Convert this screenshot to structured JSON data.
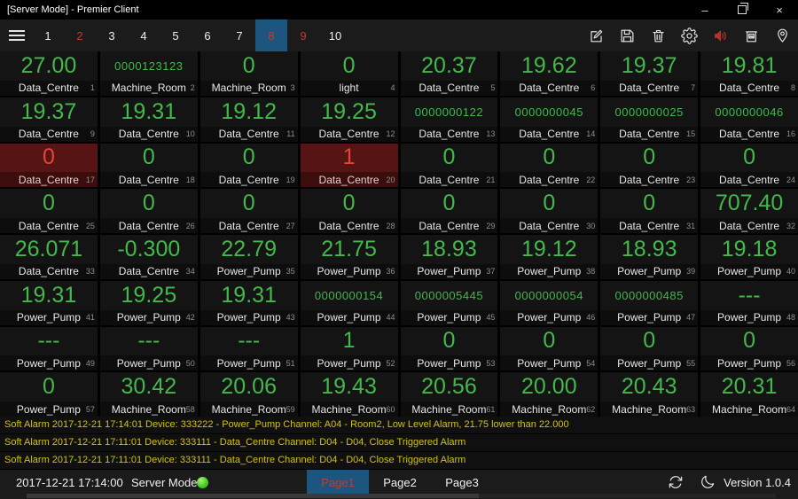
{
  "window": {
    "title": "[Server Mode] - Premier Client",
    "controls": [
      {
        "name": "minimize",
        "glyph": "–"
      },
      {
        "name": "restore",
        "glyph": ""
      },
      {
        "name": "close",
        "glyph": "×"
      }
    ]
  },
  "toolbar": {
    "pages": [
      {
        "label": "1",
        "state": "normal"
      },
      {
        "label": "2",
        "state": "alarm"
      },
      {
        "label": "3",
        "state": "normal"
      },
      {
        "label": "4",
        "state": "normal"
      },
      {
        "label": "5",
        "state": "normal"
      },
      {
        "label": "6",
        "state": "normal"
      },
      {
        "label": "7",
        "state": "normal"
      },
      {
        "label": "8",
        "state": "active"
      },
      {
        "label": "9",
        "state": "alarm"
      },
      {
        "label": "10",
        "state": "normal"
      }
    ],
    "icons": [
      "edit",
      "save",
      "delete",
      "settings",
      "alarm-sound",
      "snapshot",
      "location"
    ]
  },
  "grid": {
    "cells": [
      {
        "value": "27.00",
        "label": "Data_Centre",
        "index": 1,
        "state": "normal"
      },
      {
        "value": "0000123123",
        "label": "Machine_Room",
        "index": 2,
        "state": "normal"
      },
      {
        "value": "0",
        "label": "Machine_Room",
        "index": 3,
        "state": "normal"
      },
      {
        "value": "0",
        "label": "light",
        "index": 4,
        "state": "normal"
      },
      {
        "value": "20.37",
        "label": "Data_Centre",
        "index": 5,
        "state": "normal"
      },
      {
        "value": "19.62",
        "label": "Data_Centre",
        "index": 6,
        "state": "normal"
      },
      {
        "value": "19.37",
        "label": "Data_Centre",
        "index": 7,
        "state": "normal"
      },
      {
        "value": "19.81",
        "label": "Data_Centre",
        "index": 8,
        "state": "normal"
      },
      {
        "value": "19.37",
        "label": "Data_Centre",
        "index": 9,
        "state": "normal"
      },
      {
        "value": "19.31",
        "label": "Data_Centre",
        "index": 10,
        "state": "normal"
      },
      {
        "value": "19.12",
        "label": "Data_Centre",
        "index": 11,
        "state": "normal"
      },
      {
        "value": "19.25",
        "label": "Data_Centre",
        "index": 12,
        "state": "normal"
      },
      {
        "value": "0000000122",
        "label": "Data_Centre",
        "index": 13,
        "state": "normal"
      },
      {
        "value": "0000000045",
        "label": "Data_Centre",
        "index": 14,
        "state": "normal"
      },
      {
        "value": "0000000025",
        "label": "Data_Centre",
        "index": 15,
        "state": "normal"
      },
      {
        "value": "0000000046",
        "label": "Data_Centre",
        "index": 16,
        "state": "normal"
      },
      {
        "value": "0",
        "label": "Data_Centre",
        "index": 17,
        "state": "alarm"
      },
      {
        "value": "0",
        "label": "Data_Centre",
        "index": 18,
        "state": "normal"
      },
      {
        "value": "0",
        "label": "Data_Centre",
        "index": 19,
        "state": "normal"
      },
      {
        "value": "1",
        "label": "Data_Centre",
        "index": 20,
        "state": "alarm"
      },
      {
        "value": "0",
        "label": "Data_Centre",
        "index": 21,
        "state": "normal"
      },
      {
        "value": "0",
        "label": "Data_Centre",
        "index": 22,
        "state": "normal"
      },
      {
        "value": "0",
        "label": "Data_Centre",
        "index": 23,
        "state": "normal"
      },
      {
        "value": "0",
        "label": "Data_Centre",
        "index": 24,
        "state": "normal"
      },
      {
        "value": "0",
        "label": "Data_Centre",
        "index": 25,
        "state": "normal"
      },
      {
        "value": "0",
        "label": "Data_Centre",
        "index": 26,
        "state": "normal"
      },
      {
        "value": "0",
        "label": "Data_Centre",
        "index": 27,
        "state": "normal"
      },
      {
        "value": "0",
        "label": "Data_Centre",
        "index": 28,
        "state": "normal"
      },
      {
        "value": "0",
        "label": "Data_Centre",
        "index": 29,
        "state": "normal"
      },
      {
        "value": "0",
        "label": "Data_Centre",
        "index": 30,
        "state": "normal"
      },
      {
        "value": "0",
        "label": "Data_Centre",
        "index": 31,
        "state": "normal"
      },
      {
        "value": "707.40",
        "label": "Data_Centre",
        "index": 32,
        "state": "normal"
      },
      {
        "value": "26.071",
        "label": "Data_Centre",
        "index": 33,
        "state": "normal"
      },
      {
        "value": "-0.300",
        "label": "Data_Centre",
        "index": 34,
        "state": "normal"
      },
      {
        "value": "22.79",
        "label": "Power_Pump",
        "index": 35,
        "state": "normal"
      },
      {
        "value": "21.75",
        "label": "Power_Pump",
        "index": 36,
        "state": "normal"
      },
      {
        "value": "18.93",
        "label": "Power_Pump",
        "index": 37,
        "state": "normal"
      },
      {
        "value": "19.12",
        "label": "Power_Pump",
        "index": 38,
        "state": "normal"
      },
      {
        "value": "18.93",
        "label": "Power_Pump",
        "index": 39,
        "state": "normal"
      },
      {
        "value": "19.18",
        "label": "Power_Pump",
        "index": 40,
        "state": "normal"
      },
      {
        "value": "19.31",
        "label": "Power_Pump",
        "index": 41,
        "state": "normal"
      },
      {
        "value": "19.25",
        "label": "Power_Pump",
        "index": 42,
        "state": "normal"
      },
      {
        "value": "19.31",
        "label": "Power_Pump",
        "index": 43,
        "state": "normal"
      },
      {
        "value": "0000000154",
        "label": "Power_Pump",
        "index": 44,
        "state": "normal"
      },
      {
        "value": "0000005445",
        "label": "Power_Pump",
        "index": 45,
        "state": "normal"
      },
      {
        "value": "0000000054",
        "label": "Power_Pump",
        "index": 46,
        "state": "normal"
      },
      {
        "value": "0000000485",
        "label": "Power_Pump",
        "index": 47,
        "state": "normal"
      },
      {
        "value": "---",
        "label": "Power_Pump",
        "index": 48,
        "state": "normal"
      },
      {
        "value": "---",
        "label": "Power_Pump",
        "index": 49,
        "state": "normal"
      },
      {
        "value": "---",
        "label": "Power_Pump",
        "index": 50,
        "state": "normal"
      },
      {
        "value": "---",
        "label": "Power_Pump",
        "index": 51,
        "state": "normal"
      },
      {
        "value": "1",
        "label": "Power_Pump",
        "index": 52,
        "state": "normal"
      },
      {
        "value": "0",
        "label": "Power_Pump",
        "index": 53,
        "state": "normal"
      },
      {
        "value": "0",
        "label": "Power_Pump",
        "index": 54,
        "state": "normal"
      },
      {
        "value": "0",
        "label": "Power_Pump",
        "index": 55,
        "state": "normal"
      },
      {
        "value": "0",
        "label": "Power_Pump",
        "index": 56,
        "state": "normal"
      },
      {
        "value": "0",
        "label": "Power_Pump",
        "index": 57,
        "state": "normal"
      },
      {
        "value": "30.42",
        "label": "Machine_Room",
        "index": 58,
        "state": "normal"
      },
      {
        "value": "20.06",
        "label": "Machine_Room",
        "index": 59,
        "state": "normal"
      },
      {
        "value": "19.43",
        "label": "Machine_Room",
        "index": 60,
        "state": "normal"
      },
      {
        "value": "20.56",
        "label": "Machine_Room",
        "index": 61,
        "state": "normal"
      },
      {
        "value": "20.00",
        "label": "Machine_Room",
        "index": 62,
        "state": "normal"
      },
      {
        "value": "20.43",
        "label": "Machine_Room",
        "index": 63,
        "state": "normal"
      },
      {
        "value": "20.31",
        "label": "Machine_Room",
        "index": 64,
        "state": "normal"
      }
    ]
  },
  "alarms": [
    "Soft Alarm 2017-12-21 17:14:01 Device: 333222 - Power_Pump Channel: A04 - Room2, Low Level Alarm, 21.75 lower than 22.000",
    "Soft Alarm 2017-12-21 17:11:01 Device: 333111 - Data_Centre Channel: D04 - D04, Close Triggered Alarm",
    "Soft Alarm 2017-12-21 17:11:01 Device: 333111 - Data_Centre Channel: D04 - D04, Close Triggered Alarm"
  ],
  "statusbar": {
    "timestamp": "2017-12-21 17:14:00",
    "mode_label": "Server Mode",
    "led_state": "on",
    "tabs": [
      "Page1",
      "Page2",
      "Page3"
    ],
    "active_tab": "Page1",
    "icons": [
      "sync",
      "night-mode"
    ],
    "version": "Version 1.0.4"
  },
  "colors": {
    "value_green": "#44b84b",
    "alarm_value_red": "#e2443a",
    "alarm_cell_bg": "#561414",
    "accent_blue": "#1c567e",
    "page_alarm_red": "#c23b31",
    "alarm_text_yellow": "#d2c400",
    "led_green": "#46cf22"
  }
}
